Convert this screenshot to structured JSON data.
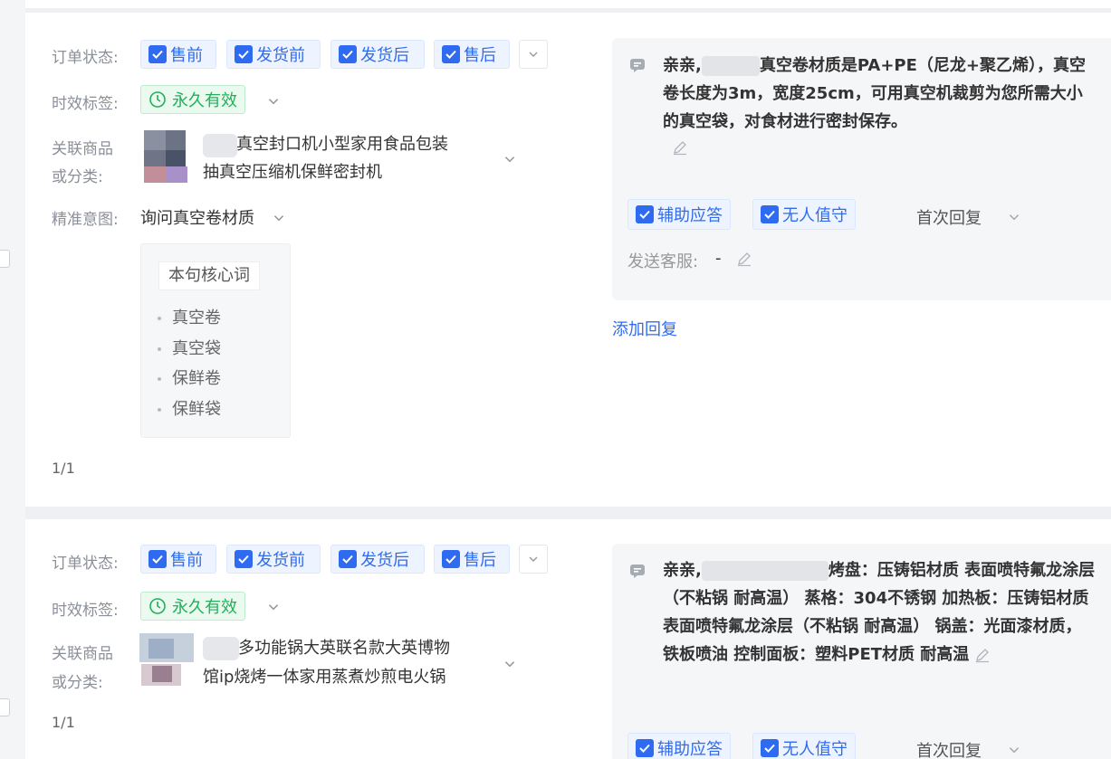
{
  "colors": {
    "accent": "#2f6bf0",
    "success": "#20b05a",
    "muted": "#8a8f99"
  },
  "labels": {
    "order_status": "订单状态:",
    "validity": "时效标签:",
    "related_line1": "关联商品",
    "related_line2": "或分类:",
    "intent": "精准意图:",
    "send_agent": "发送客服:",
    "core_words_title": "本句核心词",
    "add_reply": "添加回复"
  },
  "status_options": [
    "售前",
    "发货前",
    "发货后",
    "售后"
  ],
  "validity_value": "永久有效",
  "reply_options": {
    "assist": "辅助应答",
    "unattended": "无人值守",
    "first_reply": "首次回复"
  },
  "cards": [
    {
      "product_line1": "真空封口机小型家用食品包装",
      "product_line2": "抽真空压缩机保鲜密封机",
      "intent_value": "询问真空卷材质",
      "core_words": [
        "真空卷",
        "真空袋",
        "保鲜卷",
        "保鲜袋"
      ],
      "pager": "1/1",
      "reply_prefix": "亲亲,",
      "reply_body": "真空卷材质是PA+PE（尼龙+聚乙烯），真空卷长度为3m，宽度25cm，可用真空机裁剪为您所需大小的真空袋，对食材进行密封保存。",
      "send_agent_value": "-"
    },
    {
      "product_line1": "多功能锅大英联名款大英博物",
      "product_line2": "馆ip烧烤一体家用蒸煮炒煎电火锅",
      "pager": "1/1",
      "reply_prefix": "亲亲,",
      "reply_body": "烤盘：压铸铝材质 表面喷特氟龙涂层（不粘锅 耐高温） 蒸格：304不锈钢 加热板：压铸铝材质 表面喷特氟龙涂层（不粘锅 耐高温） 锅盖：光面漆材质，铁板喷油 控制面板：塑料PET材质 耐高温"
    }
  ]
}
